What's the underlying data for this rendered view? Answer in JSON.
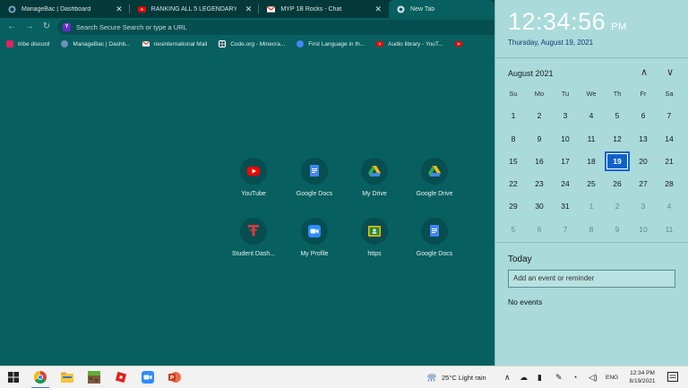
{
  "browser": {
    "tabs": [
      {
        "title": "ManageBac | Dashboard",
        "icon": "managebac-icon",
        "close": "✕"
      },
      {
        "title": "RANKING ALL 5 LEGENDARY BR",
        "icon": "youtube-icon",
        "close": "✕"
      },
      {
        "title": "MYP 1B Rocks - Chat",
        "icon": "gmail-icon",
        "close": "✕"
      },
      {
        "title": "New Tab",
        "icon": "chrome-icon",
        "close": "✕"
      }
    ],
    "omnibox_placeholder": "Search Secure Search or type a URL",
    "bookmarks": [
      {
        "label": "tribe discord",
        "icon": "youtube-icon",
        "color": "#e0245e"
      },
      {
        "label": "ManageBac | Dashb...",
        "icon": "managebac-icon",
        "color": "#6c8fb5"
      },
      {
        "label": "nesinternational Mail",
        "icon": "gmail-icon",
        "color": "#ea4335"
      },
      {
        "label": "Code.org - Minecra...",
        "icon": "code-org-icon",
        "color": "#ffffff"
      },
      {
        "label": "First Language in th...",
        "icon": "google-icon",
        "color": "#4285f4"
      },
      {
        "label": "Audio library - YouT...",
        "icon": "youtube-icon",
        "color": "#ff0000"
      }
    ],
    "shortcuts": [
      {
        "label": "YouTube",
        "icon": "youtube-icon"
      },
      {
        "label": "Google Docs",
        "icon": "google-docs-icon"
      },
      {
        "label": "My Drive",
        "icon": "google-drive-icon"
      },
      {
        "label": "Google Drive",
        "icon": "google-drive-icon"
      },
      {
        "label": "Student Dash...",
        "icon": "student-dash-icon"
      },
      {
        "label": "My Profile",
        "icon": "zoom-icon"
      },
      {
        "label": "https",
        "icon": "classroom-icon"
      },
      {
        "label": "Google Docs",
        "icon": "google-docs-icon"
      }
    ]
  },
  "calendar": {
    "time": "12:34:56",
    "ampm": "PM",
    "full_date": "Thursday, August 19, 2021",
    "month_label": "August 2021",
    "weekdays": [
      "Su",
      "Mo",
      "Tu",
      "We",
      "Th",
      "Fr",
      "Sa"
    ],
    "weeks": [
      [
        "1",
        "2",
        "3",
        "4",
        "5",
        "6",
        "7"
      ],
      [
        "8",
        "9",
        "10",
        "11",
        "12",
        "13",
        "14"
      ],
      [
        "15",
        "16",
        "17",
        "18",
        "19",
        "20",
        "21"
      ],
      [
        "22",
        "23",
        "24",
        "25",
        "26",
        "27",
        "28"
      ],
      [
        "29",
        "30",
        "31",
        "1",
        "2",
        "3",
        "4"
      ],
      [
        "5",
        "6",
        "7",
        "8",
        "9",
        "10",
        "11"
      ]
    ],
    "today_day": "19",
    "today_heading": "Today",
    "event_placeholder": "Add an event or reminder",
    "no_events": "No events"
  },
  "taskbar": {
    "weather": "25°C  Light rain",
    "language": "ENG",
    "clock_time": "12:34 PM",
    "clock_date": "8/19/2021"
  }
}
